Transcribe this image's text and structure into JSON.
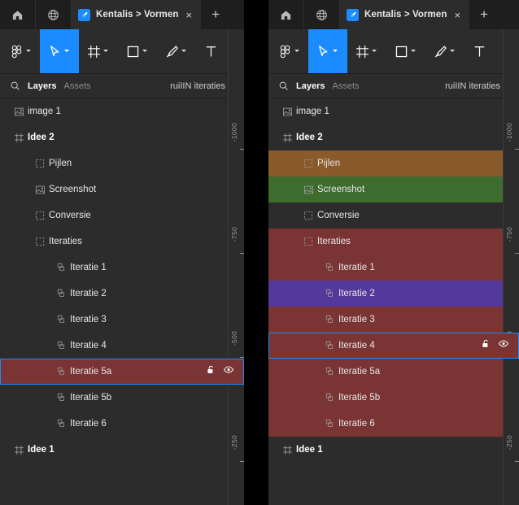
{
  "window": {
    "background": "#2c2c2c",
    "accent": "#1a8cff"
  },
  "tabbar": {
    "home_icon": "home-icon",
    "globe_icon": "globe-icon",
    "tab_favicon_icon": "figma-pen-icon",
    "tab_title": "Kentalis > Vormen",
    "close_label": "×",
    "new_tab_label": "+"
  },
  "toolbar": {
    "items": [
      {
        "name": "main-menu",
        "icon": "figma-logo-icon",
        "caret": true,
        "active": false
      },
      {
        "name": "move-tool",
        "icon": "cursor-arrow-icon",
        "caret": true,
        "active": true
      },
      {
        "name": "frame-tool",
        "icon": "frame-icon",
        "caret": true,
        "active": false
      },
      {
        "name": "shape-tool",
        "icon": "square-icon",
        "caret": true,
        "active": false
      },
      {
        "name": "pen-tool",
        "icon": "pen-icon",
        "caret": true,
        "active": false
      },
      {
        "name": "text-tool",
        "icon": "text-T-icon",
        "caret": false,
        "active": false
      },
      {
        "name": "resources-tool",
        "icon": "components-icon",
        "caret": false,
        "active": false
      }
    ]
  },
  "panel_header": {
    "search_icon": "search-icon",
    "tab_layers": "Layers",
    "tab_assets": "Assets",
    "page_name": "ruiIIN iteraties",
    "page_caret_icon": "chevron-down-icon"
  },
  "ruler": {
    "labels": [
      "-1000",
      "-750",
      "-500",
      "-250"
    ]
  },
  "left_pane": {
    "rows": [
      {
        "label": "image 1",
        "icon": "image-icon",
        "indent": 0,
        "bold": false,
        "bg": "none",
        "selected": false,
        "actions": false
      },
      {
        "label": "Idee 2",
        "icon": "frame-icon",
        "indent": 0,
        "bold": true,
        "bg": "none",
        "selected": false,
        "actions": false
      },
      {
        "label": "Pijlen",
        "icon": "group-icon",
        "indent": 1,
        "bold": false,
        "bg": "none",
        "selected": false,
        "actions": false
      },
      {
        "label": "Screenshot",
        "icon": "image-icon",
        "indent": 1,
        "bold": false,
        "bg": "none",
        "selected": false,
        "actions": false
      },
      {
        "label": "Conversie",
        "icon": "group-icon",
        "indent": 1,
        "bold": false,
        "bg": "none",
        "selected": false,
        "actions": false
      },
      {
        "label": "Iteraties",
        "icon": "group-icon",
        "indent": 1,
        "bold": false,
        "bg": "none",
        "selected": false,
        "actions": false
      },
      {
        "label": "Iteratie 1",
        "icon": "component-icon",
        "indent": 2,
        "bold": false,
        "bg": "none",
        "selected": false,
        "actions": false
      },
      {
        "label": "Iteratie 2",
        "icon": "component-icon",
        "indent": 2,
        "bold": false,
        "bg": "none",
        "selected": false,
        "actions": false
      },
      {
        "label": "Iteratie 3",
        "icon": "component-icon",
        "indent": 2,
        "bold": false,
        "bg": "none",
        "selected": false,
        "actions": false
      },
      {
        "label": "Iteratie 4",
        "icon": "component-icon",
        "indent": 2,
        "bold": false,
        "bg": "none",
        "selected": false,
        "actions": false
      },
      {
        "label": "Iteratie 5a",
        "icon": "component-icon",
        "indent": 2,
        "bold": false,
        "bg": "#7a3434",
        "selected": true,
        "actions": true
      },
      {
        "label": "Iteratie 5b",
        "icon": "component-icon",
        "indent": 2,
        "bold": false,
        "bg": "none",
        "selected": false,
        "actions": false
      },
      {
        "label": "Iteratie 6",
        "icon": "component-icon",
        "indent": 2,
        "bold": false,
        "bg": "none",
        "selected": false,
        "actions": false
      },
      {
        "label": "Idee 1",
        "icon": "frame-icon",
        "indent": 0,
        "bold": true,
        "bg": "none",
        "selected": false,
        "actions": false
      }
    ]
  },
  "right_pane": {
    "rows": [
      {
        "label": "image 1",
        "icon": "image-icon",
        "indent": 0,
        "bold": false,
        "bg": "none",
        "selected": false,
        "actions": false
      },
      {
        "label": "Idee 2",
        "icon": "frame-icon",
        "indent": 0,
        "bold": true,
        "bg": "none",
        "selected": false,
        "actions": false
      },
      {
        "label": "Pijlen",
        "icon": "group-icon",
        "indent": 1,
        "bold": false,
        "bg": "#8a5a2b",
        "selected": false,
        "actions": false
      },
      {
        "label": "Screenshot",
        "icon": "image-icon",
        "indent": 1,
        "bold": false,
        "bg": "#3e6b2e",
        "selected": false,
        "actions": false
      },
      {
        "label": "Conversie",
        "icon": "group-icon",
        "indent": 1,
        "bold": false,
        "bg": "none",
        "selected": false,
        "actions": false
      },
      {
        "label": "Iteraties",
        "icon": "group-icon",
        "indent": 1,
        "bold": false,
        "bg": "#7a3434",
        "selected": false,
        "actions": false
      },
      {
        "label": "Iteratie 1",
        "icon": "component-icon",
        "indent": 2,
        "bold": false,
        "bg": "#7a3434",
        "selected": false,
        "actions": false
      },
      {
        "label": "Iteratie 2",
        "icon": "component-icon",
        "indent": 2,
        "bold": false,
        "bg": "#55389c",
        "selected": false,
        "actions": false
      },
      {
        "label": "Iteratie 3",
        "icon": "component-icon",
        "indent": 2,
        "bold": false,
        "bg": "#7a3434",
        "selected": false,
        "actions": false
      },
      {
        "label": "Iteratie 4",
        "icon": "component-icon",
        "indent": 2,
        "bold": false,
        "bg": "#7a3434",
        "selected": true,
        "actions": true
      },
      {
        "label": "Iteratie 5a",
        "icon": "component-icon",
        "indent": 2,
        "bold": false,
        "bg": "#7a3434",
        "selected": false,
        "actions": false
      },
      {
        "label": "Iteratie 5b",
        "icon": "component-icon",
        "indent": 2,
        "bold": false,
        "bg": "#7a3434",
        "selected": false,
        "actions": false
      },
      {
        "label": "Iteratie 6",
        "icon": "component-icon",
        "indent": 2,
        "bold": false,
        "bg": "#7a3434",
        "selected": false,
        "actions": false
      },
      {
        "label": "Idee 1",
        "icon": "frame-icon",
        "indent": 0,
        "bold": true,
        "bg": "none",
        "selected": false,
        "actions": false
      }
    ]
  },
  "row_actions": {
    "lock_icon": "unlock-icon",
    "visibility_icon": "eye-icon"
  }
}
